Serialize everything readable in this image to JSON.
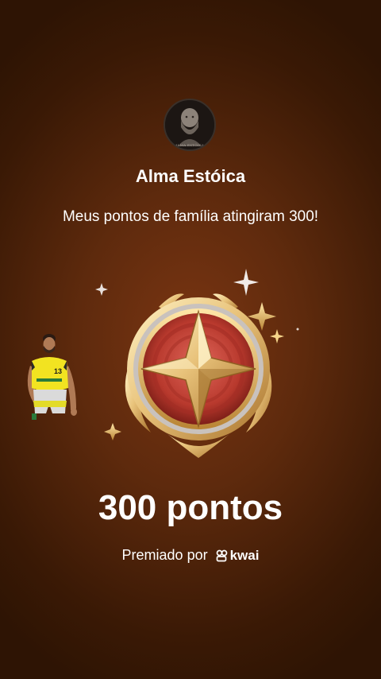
{
  "profile": {
    "avatar_caption": "ALMA ESTÓICA",
    "name": "Alma Estóica"
  },
  "announcement": {
    "message": "Meus pontos de família atingiram 300!"
  },
  "reward": {
    "points_label": "300 pontos",
    "awarded_by_label": "Premiado por",
    "brand_name": "kwai"
  },
  "sticker": {
    "jersey_number": "13"
  },
  "colors": {
    "background": "#5e2a0d",
    "gold": "#e8c27a",
    "badge_red": "#b8392d",
    "jersey_yellow": "#f2e321"
  },
  "icons": {
    "badge": "star-medal-icon",
    "brand": "kwai-logo-icon"
  }
}
